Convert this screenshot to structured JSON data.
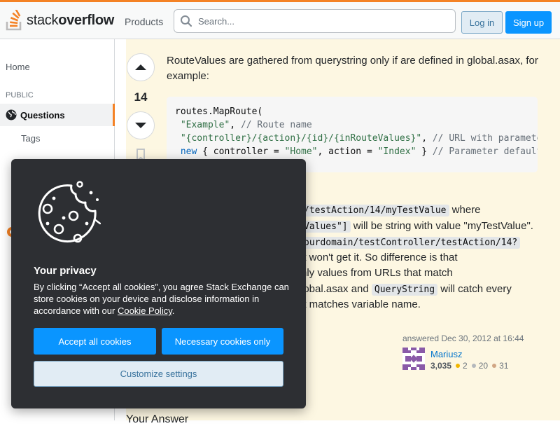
{
  "header": {
    "logo_light": "stack",
    "logo_bold": "overflow",
    "products_label": "Products",
    "search_placeholder": "Search...",
    "login_label": "Log in",
    "signup_label": "Sign up"
  },
  "leftnav": {
    "home": "Home",
    "public_heading": "PUBLIC",
    "questions": "Questions",
    "tags": "Tags"
  },
  "answer": {
    "score": "14",
    "intro": "RouteValues are gathered from querystring only if are defined in global.asax, for example:",
    "code": {
      "l1": "routes.MapRoute(",
      "l2_str": "\"Example\"",
      "l2_cm": "// Route name",
      "l3_str": "\"{controller}/{action}/{id}/{inRouteValues}\"",
      "l3_cm": "// URL with parameter",
      "l4_kw": "new",
      "l4_a": "{ controller = ",
      "l4_s1": "\"Home\"",
      "l4_b": ", action = ",
      "l4_s2": "\"Index\"",
      "l4_c": " }",
      "l4_cm": "// Parameter defaults",
      "l5": ");"
    },
    "line1_code": "/testAction/14/myTestValue",
    "line1_text": "where",
    "line2_code": "Values\"]",
    "line2_text": "will be string with value \"myTestValue\".",
    "line3_code": "ourdomain/testController/testAction/14?",
    "line4_text": "it won't get it. So difference is that",
    "line5_text": "nly values from URLs that match",
    "line6_text_a": "lobal.asax and",
    "line6_code": "QueryString",
    "line6_text_b": "will catch every",
    "line7_text": "it matches variable name.",
    "answered": "answered Dec 30, 2012 at 16:44",
    "user_name": "Mariusz",
    "reputation": "3,035",
    "gold": "2",
    "silver": "20",
    "bronze": "31",
    "your_answer": "Your Answer"
  },
  "colors": {
    "accent": "#f48225",
    "primary": "#0a95ff",
    "highlight_bg": "#fdf7e2",
    "gold": "#f1b600",
    "silver": "#b4b8bc",
    "bronze": "#d1a684"
  },
  "cookie": {
    "title": "Your privacy",
    "body_pre": "By clicking “Accept all cookies”, you agree Stack Exchange can store cookies on your device and disclose information in accordance with our ",
    "policy_link": "Cookie Policy",
    "body_post": ".",
    "accept": "Accept all cookies",
    "necessary": "Necessary cookies only",
    "customize": "Customize settings"
  }
}
